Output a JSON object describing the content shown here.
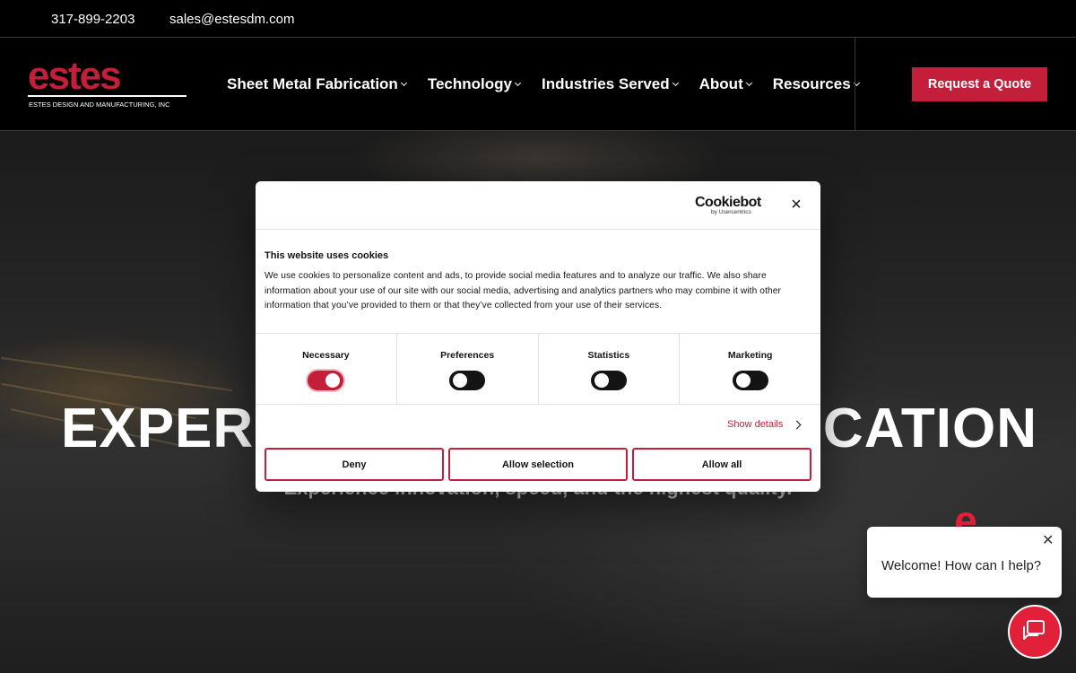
{
  "topbar": {
    "phone": "317-899-2203",
    "email": "sales@estesdm.com"
  },
  "header": {
    "logo_word": "estes",
    "logo_tagline": "ESTES DESIGN AND MANUFACTURING, INC",
    "nav": [
      {
        "label": "Sheet Metal Fabrication"
      },
      {
        "label": "Technology"
      },
      {
        "label": "Industries Served"
      },
      {
        "label": "About"
      },
      {
        "label": "Resources"
      }
    ],
    "cta_label": "Request a Quote"
  },
  "hero": {
    "title": "EXPERIENCE METAL FABRICATION",
    "subtitle": "Experience innovation, speed, and the highest quality."
  },
  "cookie": {
    "brand": "Cookiebot",
    "brand_sub": "by Usercentrics",
    "heading": "This website uses cookies",
    "description": "We use cookies to personalize content and ads, to provide social media features and to analyze our traffic. We also share information about your use of our site with our social media, advertising and analytics partners who may combine it with other information that you’ve provided to them or that they’ve collected from your use of their services.",
    "toggles": [
      {
        "label": "Necessary",
        "on": true
      },
      {
        "label": "Preferences",
        "on": false
      },
      {
        "label": "Statistics",
        "on": false
      },
      {
        "label": "Marketing",
        "on": false
      }
    ],
    "show_details": "Show details",
    "buttons": {
      "deny": "Deny",
      "allow_selection": "Allow selection",
      "allow_all": "Allow all"
    }
  },
  "chat": {
    "avatar_letter": "e",
    "welcome": "Welcome! How can I help?"
  },
  "colors": {
    "brand_red": "#c41e3a",
    "chat_red": "#e3203a",
    "header_bg": "#000000"
  },
  "icons": [
    "chevron-down-icon",
    "close-icon",
    "chevron-right-icon",
    "chat-icon"
  ]
}
